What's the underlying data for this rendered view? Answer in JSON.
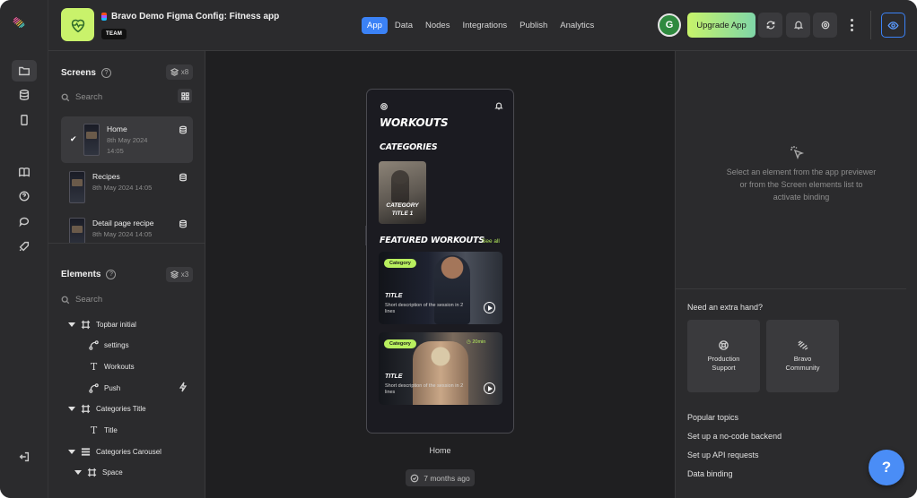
{
  "app": {
    "title": "Bravo Demo Figma Config: Fitness app",
    "badge": "TEAM"
  },
  "nav_tabs": [
    "App",
    "Data",
    "Nodes",
    "Integrations",
    "Publish",
    "Analytics"
  ],
  "active_tab": "App",
  "header": {
    "avatar_initial": "G",
    "upgrade_label": "Upgrade App"
  },
  "screens": {
    "title": "Screens",
    "count": "x8",
    "search_placeholder": "Search",
    "items": [
      {
        "name": "Home",
        "date": "8th May 2024",
        "time": "14:05",
        "selected": true
      },
      {
        "name": "Recipes",
        "date": "8th May 2024 14:05"
      },
      {
        "name": "Detail page recipe",
        "date": "8th May 2024 14:05"
      }
    ]
  },
  "elements": {
    "title": "Elements",
    "count": "x3",
    "search_placeholder": "Search",
    "tree": [
      {
        "label": "Topbar initial",
        "type": "frame",
        "depth": 0,
        "expanded": true
      },
      {
        "label": "settings",
        "type": "link",
        "depth": 1
      },
      {
        "label": "Workouts",
        "type": "text",
        "depth": 1
      },
      {
        "label": "Push",
        "type": "link",
        "depth": 1,
        "action": "bolt"
      },
      {
        "label": "Categories Title",
        "type": "frame",
        "depth": 0,
        "expanded": true
      },
      {
        "label": "Title",
        "type": "text",
        "depth": 1
      },
      {
        "label": "Categories Carousel",
        "type": "list",
        "depth": 0,
        "expanded": true
      },
      {
        "label": "Space",
        "type": "frame",
        "depth": 1,
        "expanded": true
      }
    ]
  },
  "preview": {
    "heading": "WORKOUTS",
    "categories_heading": "CATEGORIES",
    "category_card_label": "CATEGORY TITLE 1",
    "featured_heading": "FEATURED WORKOUTS",
    "see_all": "See all",
    "cards": [
      {
        "pill": "Category",
        "title": "TITLE",
        "desc": "Short description of the session in 2 lines"
      },
      {
        "pill": "Category",
        "timer": "20min",
        "title": "TITLE",
        "desc": "Short description of the session in 2 lines"
      }
    ],
    "screen_label": "Home",
    "last_updated": "7 months ago"
  },
  "right_panel": {
    "hint": "Select an element from the app previewer\nor from the Screen elements list to\nactivate binding",
    "help_title": "Need an extra hand?",
    "help_cards": [
      "Production\nSupport",
      "Bravo\nCommunity"
    ],
    "popular_title": "Popular topics",
    "topics": [
      "Set up a no-code backend",
      "Set up API requests",
      "Data binding"
    ]
  },
  "fab_label": "?",
  "colors": {
    "accent_blue": "#3b82f6",
    "brand_green": "#c9f26b",
    "panel_bg": "#2b2b2d",
    "canvas_bg": "#1f1f21"
  }
}
